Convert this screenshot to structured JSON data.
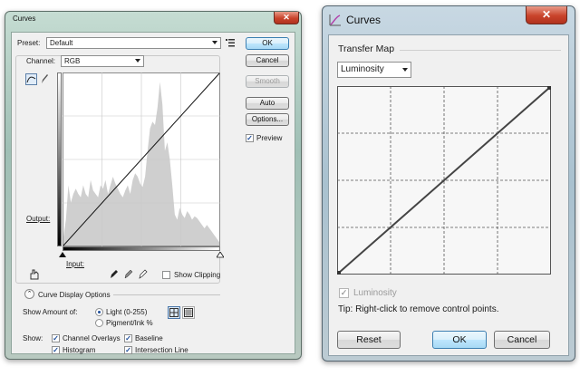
{
  "left_dialog": {
    "title": "Curves",
    "preset_label": "Preset:",
    "preset_value": "Default",
    "channel_label": "Channel:",
    "channel_value": "RGB",
    "buttons": {
      "ok": "OK",
      "cancel": "Cancel",
      "smooth": "Smooth",
      "auto": "Auto",
      "options": "Options..."
    },
    "preview_label": "Preview",
    "preview_checked": true,
    "output_label": "Output:",
    "input_label": "Input:",
    "show_clipping_label": "Show Clipping",
    "curve_display_options": "Curve Display Options",
    "show_amount_label": "Show Amount of:",
    "light_label": "Light  (0-255)",
    "pigment_label": "Pigment/Ink %",
    "show_label": "Show:",
    "channel_overlays": "Channel Overlays",
    "baseline": "Baseline",
    "histogram": "Histogram",
    "intersection_line": "Intersection Line",
    "histogram_values": [
      0.05,
      0.15,
      0.35,
      0.25,
      0.3,
      0.33,
      0.3,
      0.28,
      0.35,
      0.3,
      0.28,
      0.38,
      0.32,
      0.3,
      0.28,
      0.35,
      0.33,
      0.38,
      0.3,
      0.35,
      0.4,
      0.36,
      0.33,
      0.3,
      0.28,
      0.32,
      0.35,
      0.3,
      0.38,
      0.42,
      0.4,
      0.36,
      0.34,
      0.4,
      0.55,
      0.68,
      0.72,
      0.7,
      0.8,
      0.95,
      0.82,
      0.55,
      0.6,
      0.5,
      0.35,
      0.18,
      0.15,
      0.22,
      0.18,
      0.16,
      0.2,
      0.18,
      0.15,
      0.17,
      0.16,
      0.14,
      0.12,
      0.1,
      0.12,
      0.1,
      0.08,
      0.06,
      0.04,
      0.02
    ]
  },
  "right_dialog": {
    "title": "Curves",
    "group_label": "Transfer Map",
    "dropdown_value": "Luminosity",
    "luminosity_check_label": "Luminosity",
    "tip_text": "Tip: Right-click to remove control points.",
    "buttons": {
      "reset": "Reset",
      "ok": "OK",
      "cancel": "Cancel"
    }
  },
  "icons": {
    "ok_check": "✓",
    "close_x": "✕",
    "collapse": "⌃"
  }
}
